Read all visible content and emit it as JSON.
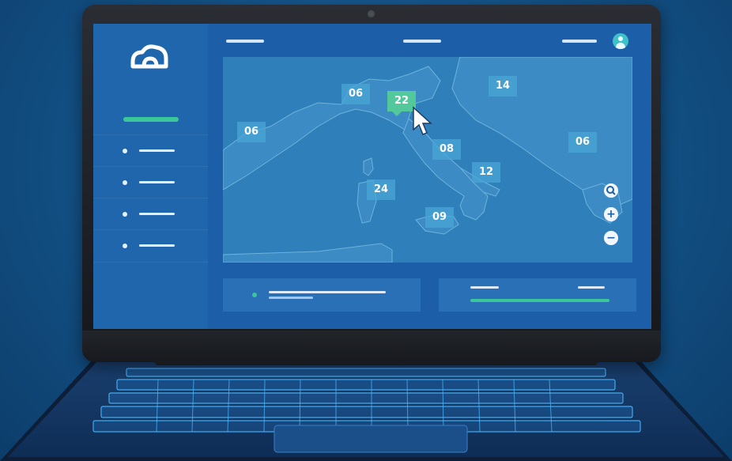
{
  "colors": {
    "background": "#14548a",
    "screen": "#1c5fa8",
    "sidebar": "#2066ad",
    "accent": "#3cc79a",
    "map_land": "#3d8bc4",
    "map_sea": "#2f7fba",
    "keyboard_glow": "#47b8ff"
  },
  "sidebar": {
    "logo_icon": "cloud-icon",
    "items": [
      {
        "icon": "dot-icon"
      },
      {
        "icon": "dot-icon"
      },
      {
        "icon": "dot-icon"
      },
      {
        "icon": "dot-icon"
      }
    ]
  },
  "header": {
    "avatar_icon": "user-icon"
  },
  "map": {
    "markers": [
      {
        "label": "06",
        "active": false
      },
      {
        "label": "22",
        "active": true
      },
      {
        "label": "14",
        "active": false
      },
      {
        "label": "06",
        "active": false
      },
      {
        "label": "08",
        "active": false
      },
      {
        "label": "06",
        "active": false
      },
      {
        "label": "12",
        "active": false
      },
      {
        "label": "24",
        "active": false
      },
      {
        "label": "09",
        "active": false
      }
    ],
    "controls": {
      "search": "search-icon",
      "zoom_in": "+",
      "zoom_out": "−"
    },
    "cursor_icon": "pointer-cursor-icon"
  }
}
